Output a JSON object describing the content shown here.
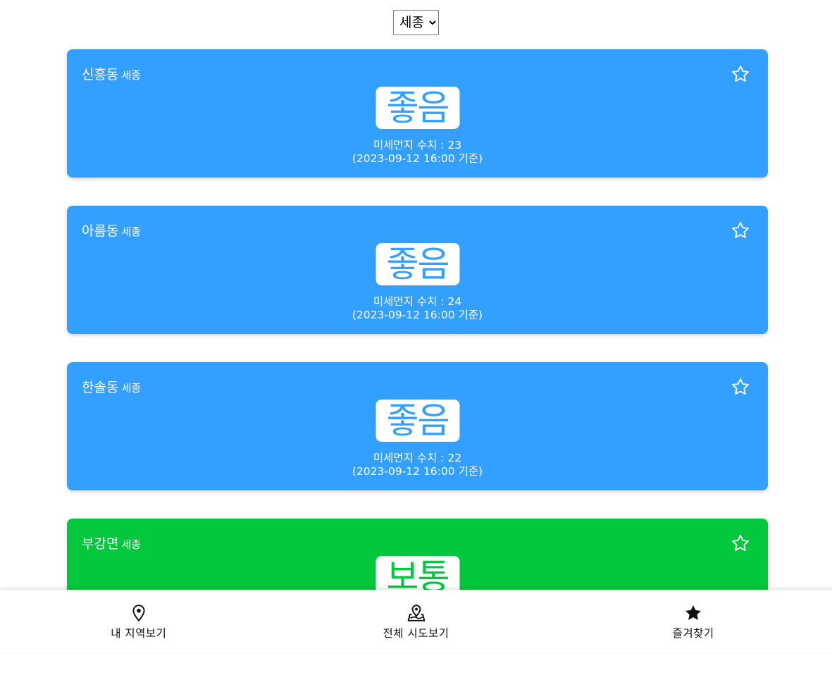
{
  "region_select": {
    "selected": "세종",
    "options": [
      "세종"
    ]
  },
  "cards": [
    {
      "station": "신흥동",
      "sido": "세종",
      "grade": "좋음",
      "pm_label": "미세먼지 수치 : 23",
      "time_label": "(2023-09-12 16:00 기준)",
      "color": "#33a0ff",
      "favorite": false
    },
    {
      "station": "아름동",
      "sido": "세종",
      "grade": "좋음",
      "pm_label": "미세먼지 수치 : 24",
      "time_label": "(2023-09-12 16:00 기준)",
      "color": "#33a0ff",
      "favorite": false
    },
    {
      "station": "한솔동",
      "sido": "세종",
      "grade": "좋음",
      "pm_label": "미세먼지 수치 : 22",
      "time_label": "(2023-09-12 16:00 기준)",
      "color": "#33a0ff",
      "favorite": false
    },
    {
      "station": "부강면",
      "sido": "세종",
      "grade": "보통",
      "pm_label": "",
      "time_label": "",
      "color": "#03c73c",
      "favorite": false
    }
  ],
  "bottom_nav": [
    {
      "label": "내 지역보기",
      "icon": "map-pin-icon"
    },
    {
      "label": "전체 시도보기",
      "icon": "map-location-icon"
    },
    {
      "label": "즐겨찾기",
      "icon": "star-filled-icon"
    }
  ]
}
